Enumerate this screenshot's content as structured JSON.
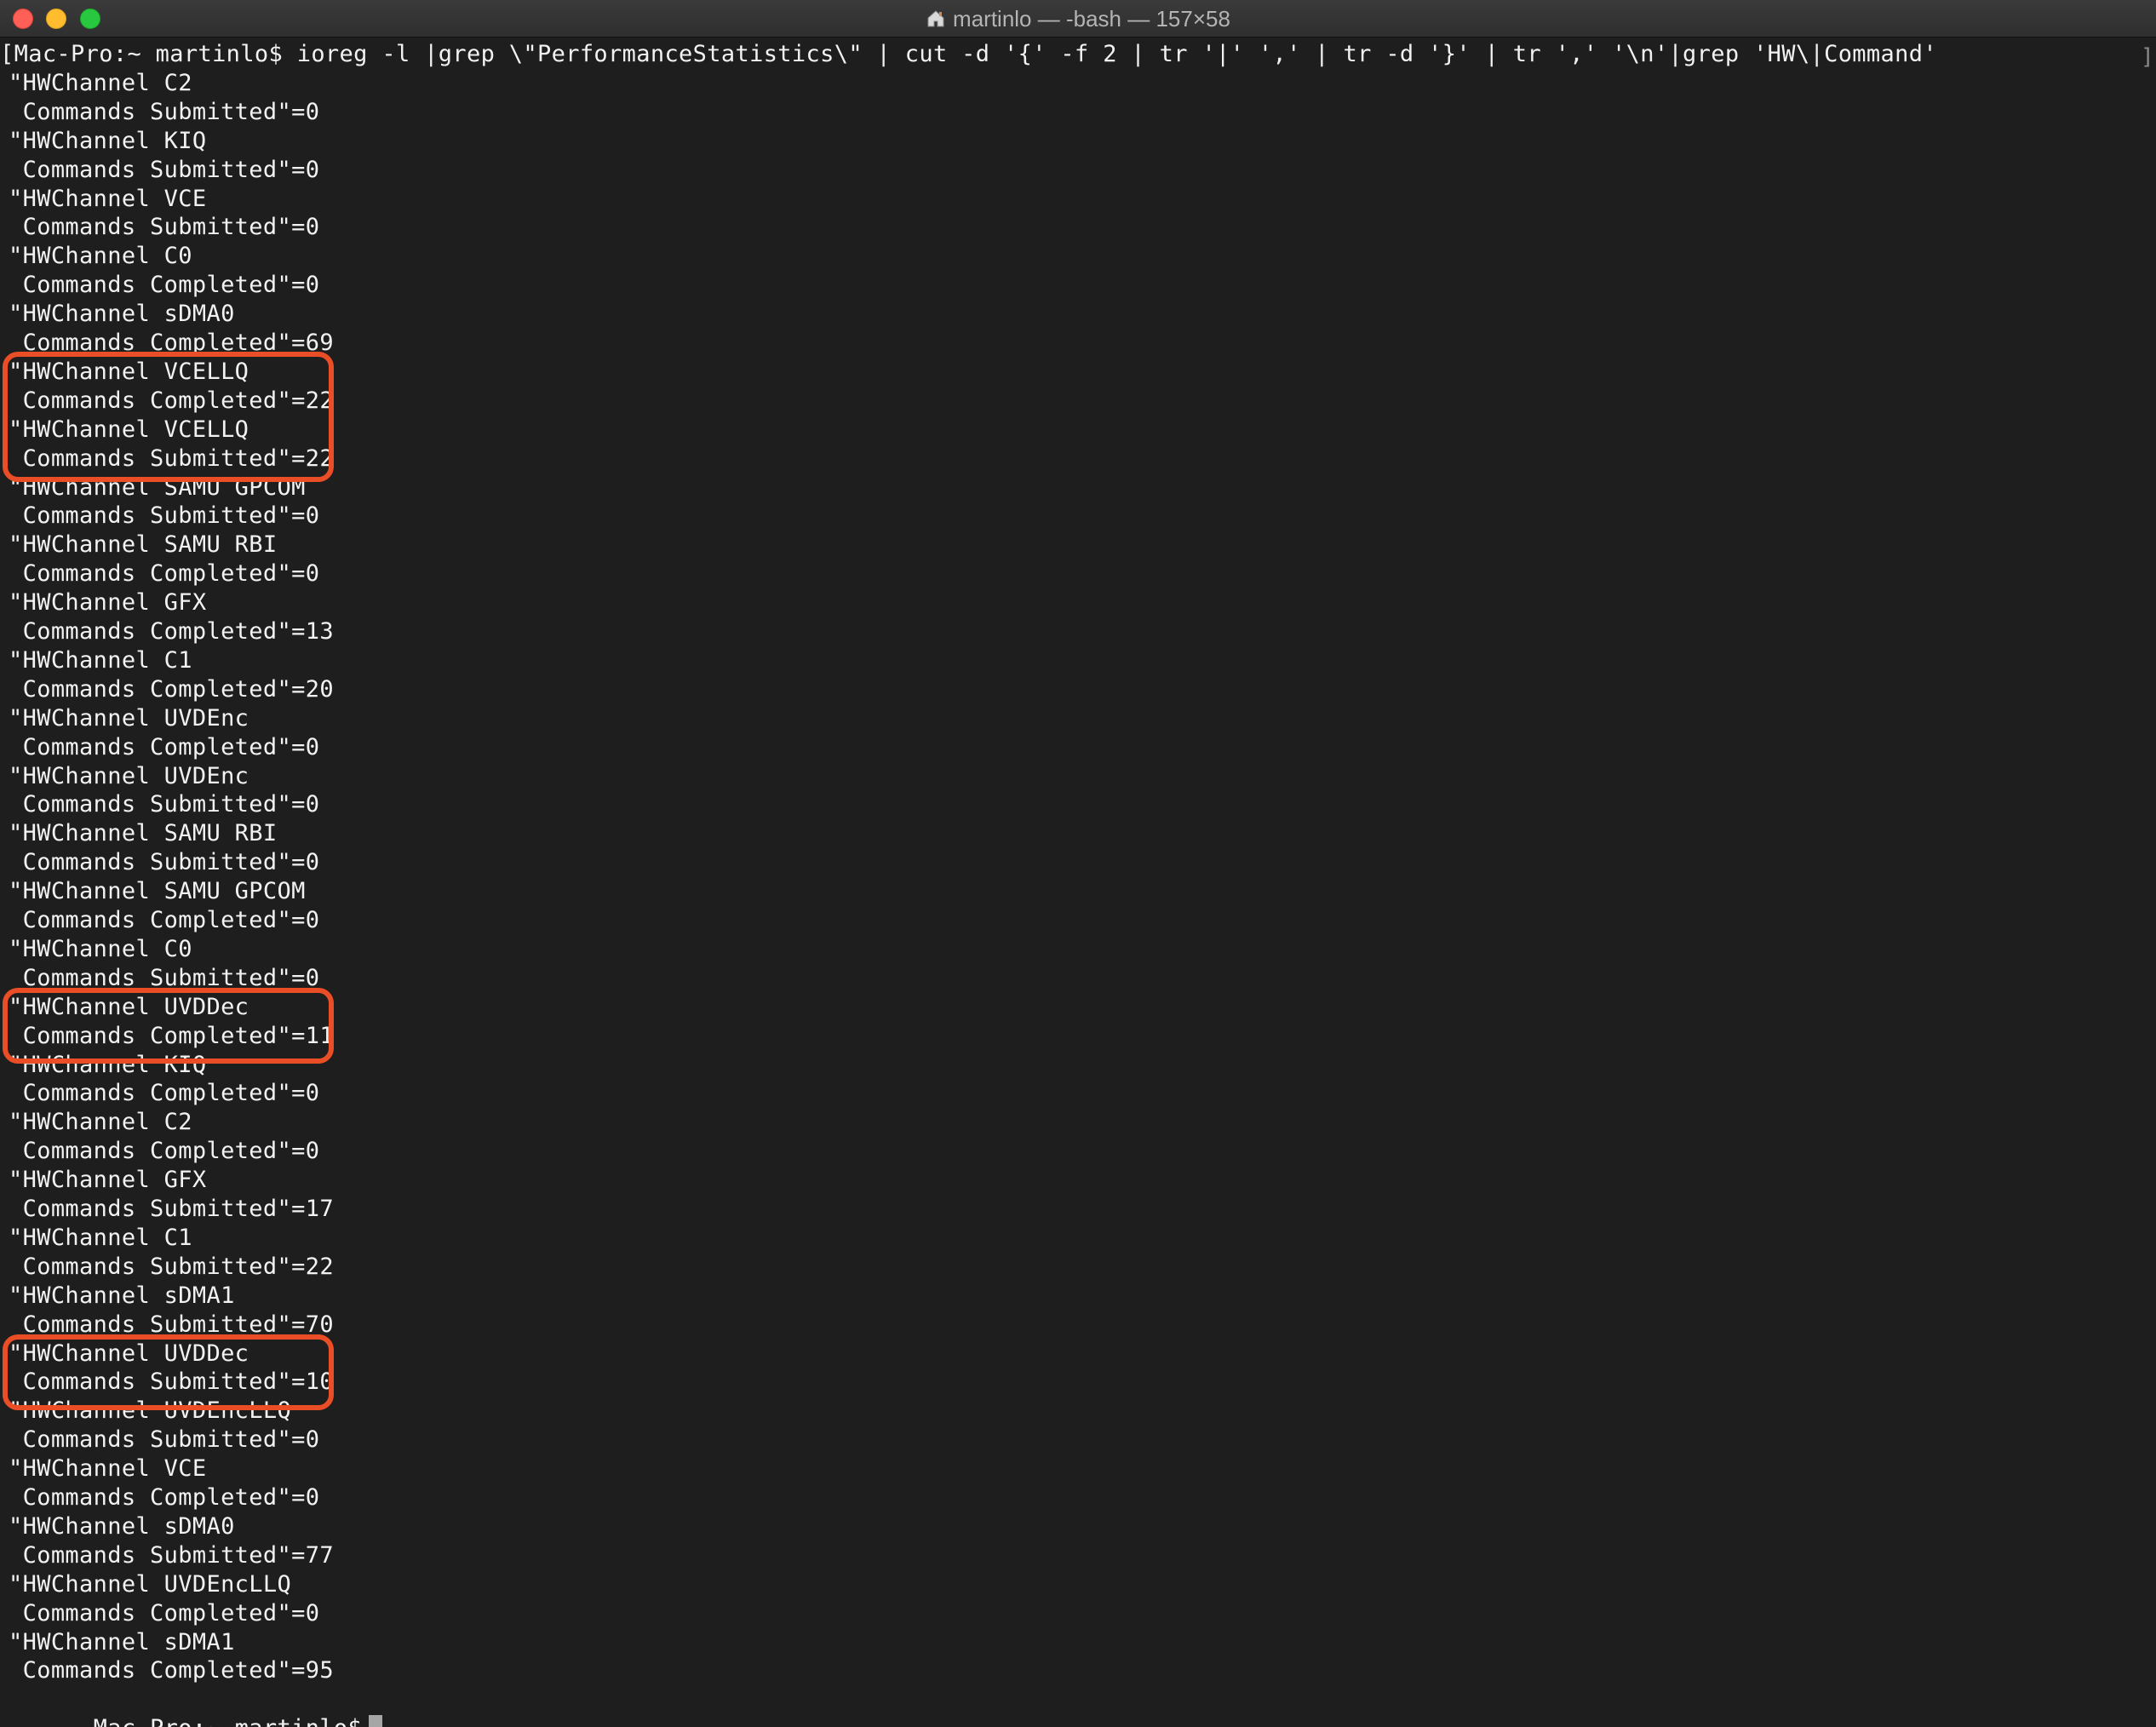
{
  "window": {
    "title": "martinlo — -bash — 157×58"
  },
  "terminal": {
    "command_line": "[Mac-Pro:~ martinlo$ ioreg -l |grep \\\"PerformanceStatistics\\\" | cut -d '{' -f 2 | tr '|' ',' | tr -d '}' | tr ',' '\\n'|grep 'HW\\|Command'",
    "right_bracket": "]",
    "lines": [
      "\"HWChannel C2",
      " Commands Submitted\"=0",
      "\"HWChannel KIQ",
      " Commands Submitted\"=0",
      "\"HWChannel VCE",
      " Commands Submitted\"=0",
      "\"HWChannel C0",
      " Commands Completed\"=0",
      "\"HWChannel sDMA0",
      " Commands Completed\"=69",
      "\"HWChannel VCELLQ",
      " Commands Completed\"=22",
      "\"HWChannel VCELLQ",
      " Commands Submitted\"=22",
      "\"HWChannel SAMU GPCOM",
      " Commands Submitted\"=0",
      "\"HWChannel SAMU RBI",
      " Commands Completed\"=0",
      "\"HWChannel GFX",
      " Commands Completed\"=13",
      "\"HWChannel C1",
      " Commands Completed\"=20",
      "\"HWChannel UVDEnc",
      " Commands Completed\"=0",
      "\"HWChannel UVDEnc",
      " Commands Submitted\"=0",
      "\"HWChannel SAMU RBI",
      " Commands Submitted\"=0",
      "\"HWChannel SAMU GPCOM",
      " Commands Completed\"=0",
      "\"HWChannel C0",
      " Commands Submitted\"=0",
      "\"HWChannel UVDDec",
      " Commands Completed\"=11",
      "\"HWChannel KIQ",
      " Commands Completed\"=0",
      "\"HWChannel C2",
      " Commands Completed\"=0",
      "\"HWChannel GFX",
      " Commands Submitted\"=17",
      "\"HWChannel C1",
      " Commands Submitted\"=22",
      "\"HWChannel sDMA1",
      " Commands Submitted\"=70",
      "\"HWChannel UVDDec",
      " Commands Submitted\"=10",
      "\"HWChannel UVDEncLLQ",
      " Commands Submitted\"=0",
      "\"HWChannel VCE",
      " Commands Completed\"=0",
      "\"HWChannel sDMA0",
      " Commands Submitted\"=77",
      "\"HWChannel UVDEncLLQ",
      " Commands Completed\"=0",
      "\"HWChannel sDMA1",
      " Commands Completed\"=95"
    ],
    "final_prompt": "Mac-Pro:~ martinlo$"
  },
  "colors": {
    "background": "#1e1e1e",
    "text": "#f2f2f2",
    "highlight": "#ea4e27",
    "close": "#fe5f57",
    "minimize": "#febc2e",
    "maximize": "#28c840"
  },
  "icons": {
    "title_icon": "home-icon"
  }
}
